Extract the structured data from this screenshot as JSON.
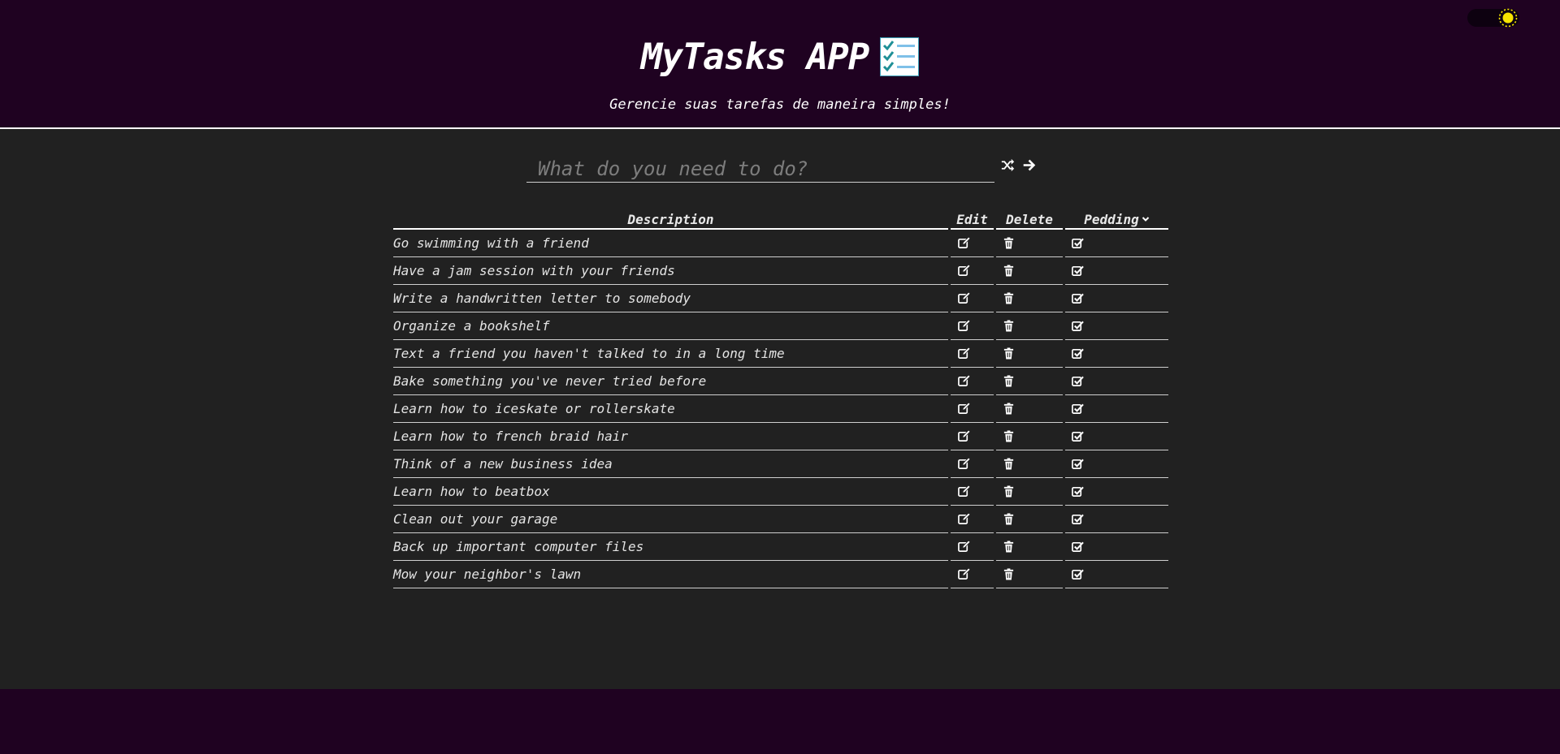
{
  "app": {
    "title": "MyTasks APP",
    "subtitle": "Gerencie suas tarefas de maneira simples!",
    "title_icon": "checklist-icon",
    "theme_toggle_icon": "sun-icon"
  },
  "task_input": {
    "placeholder": "What do you need to do?",
    "value": ""
  },
  "actions": {
    "random_icon": "shuffle-icon",
    "add_icon": "arrow-right-icon"
  },
  "table": {
    "headers": {
      "description": "Description",
      "edit": "Edit",
      "delete": "Delete",
      "pending": "Pedding"
    },
    "row_icons": {
      "edit": "edit-icon",
      "delete": "trash-icon",
      "pending": "check-square-icon"
    },
    "rows": [
      {
        "description": "Go swimming with a friend"
      },
      {
        "description": "Have a jam session with your friends"
      },
      {
        "description": "Write a handwritten letter to somebody"
      },
      {
        "description": "Organize a bookshelf"
      },
      {
        "description": "Text a friend you haven't talked to in a long time"
      },
      {
        "description": "Bake something you've never tried before"
      },
      {
        "description": "Learn how to iceskate or rollerskate"
      },
      {
        "description": "Learn how to french braid hair"
      },
      {
        "description": "Think of a new business idea"
      },
      {
        "description": "Learn how to beatbox"
      },
      {
        "description": "Clean out your garage"
      },
      {
        "description": "Back up important computer files"
      },
      {
        "description": "Mow your neighbor's lawn"
      }
    ]
  },
  "colors": {
    "header_bg": "#1f0221",
    "main_bg": "#212121",
    "text": "#ffffff",
    "sun": "#f5e400"
  }
}
